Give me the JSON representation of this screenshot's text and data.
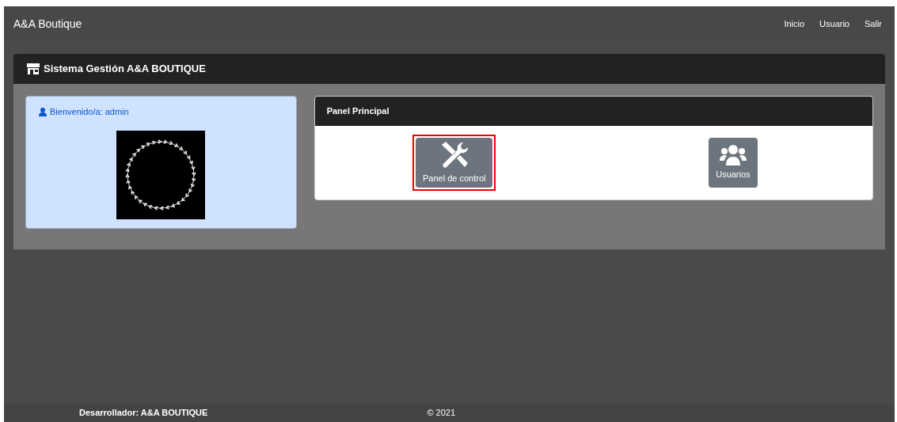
{
  "navbar": {
    "brand": "A&A Boutique",
    "links": [
      "Inicio",
      "Usuario",
      "Salir"
    ]
  },
  "header": {
    "title": "Sistema Gestión A&A BOUTIQUE"
  },
  "welcome": {
    "text": "Bienvenido/a: admin"
  },
  "panel": {
    "title": "Panel Principal",
    "buttons": [
      {
        "label": "Panel de control",
        "kind": "tools",
        "selected": true
      },
      {
        "label": "Usuarios",
        "kind": "users",
        "selected": false
      }
    ]
  },
  "footer": {
    "developer": "Desarrollador: A&A BOUTIQUE",
    "copyright": "© 2021"
  }
}
